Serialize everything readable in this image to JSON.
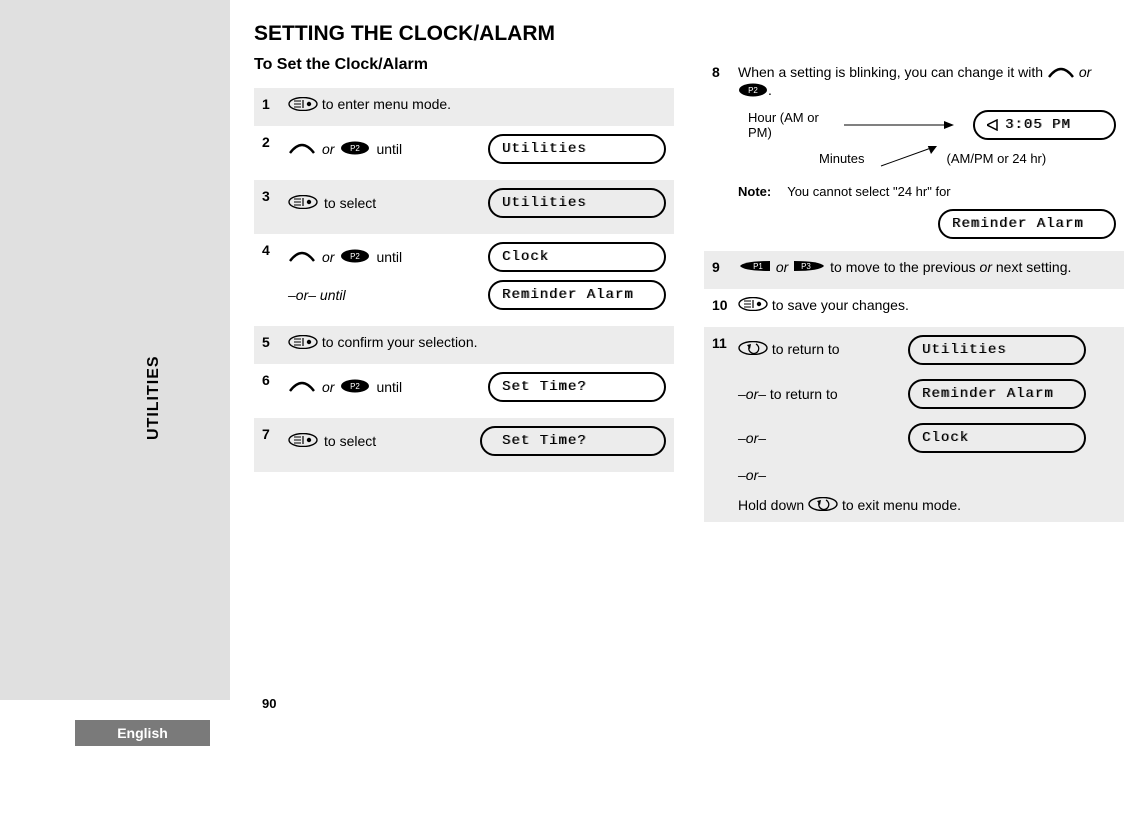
{
  "sidebar": {
    "tab": "UTILITIES",
    "language": "English"
  },
  "page_number": "90",
  "title": "SETTING THE CLOCK/ALARM",
  "subtitle": "To Set the Clock/Alarm",
  "words": {
    "or": "or",
    "or_dash": "–or–",
    "until": "until",
    "or_until": "–or– until",
    "note": "Note:"
  },
  "lcd": {
    "utilities": "Utilities",
    "clock": "Clock",
    "reminder": "Reminder Alarm",
    "settime": "Set Time?",
    "time_display": "3:05 PM"
  },
  "steps": {
    "s1": {
      "n": "1",
      "text": " to enter menu mode."
    },
    "s2": {
      "n": "2"
    },
    "s3": {
      "n": "3",
      "text": " to select"
    },
    "s4": {
      "n": "4"
    },
    "s5": {
      "n": "5",
      "text": " to confirm your selection."
    },
    "s6": {
      "n": "6"
    },
    "s7": {
      "n": "7",
      "text": " to select"
    },
    "s8": {
      "n": "8",
      "text_a": "When a setting is blinking, you can change it with ",
      "text_b": "."
    },
    "s8_labels": {
      "hour": "Hour (AM or PM)",
      "minutes": "Minutes",
      "format": "(AM/PM or 24 hr)"
    },
    "s8_note": "You cannot select \"24 hr\" for",
    "s9": {
      "n": "9",
      "text": " to move to the previous ",
      "text2": " next setting."
    },
    "s10": {
      "n": "10",
      "text": " to save your changes."
    },
    "s11": {
      "n": "11",
      "ret": " to return to",
      "ret2": " to return to",
      "exit": "Hold down ",
      "exit2": " to exit menu mode."
    }
  }
}
